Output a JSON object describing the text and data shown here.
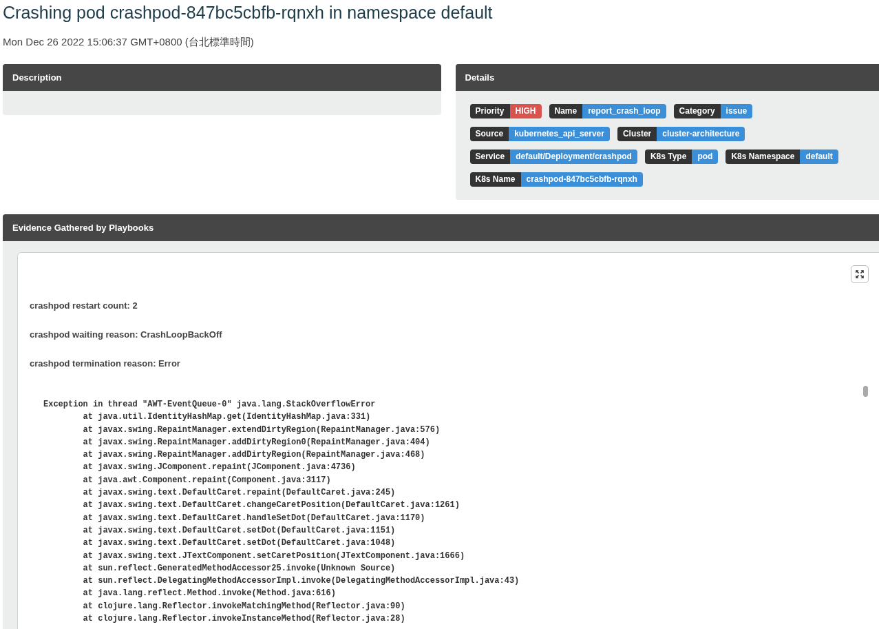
{
  "title": "Crashing pod crashpod-847bc5cbfb-rqnxh in namespace default",
  "timestamp": "Mon Dec 26 2022 15:06:37 GMT+0800 (台北標準時間)",
  "description": {
    "title": "Description"
  },
  "details": {
    "title": "Details",
    "rows": [
      [
        {
          "label": "Priority",
          "value": "HIGH",
          "color": "#d9534f"
        },
        {
          "label": "Name",
          "value": "report_crash_loop",
          "color": "#3a8fd8"
        },
        {
          "label": "Category",
          "value": "issue",
          "color": "#3a8fd8"
        }
      ],
      [
        {
          "label": "Source",
          "value": "kubernetes_api_server",
          "color": "#3a8fd8"
        },
        {
          "label": "Cluster",
          "value": "cluster-architecture",
          "color": "#3a8fd8"
        }
      ],
      [
        {
          "label": "Service",
          "value": "default/Deployment/crashpod",
          "color": "#3a8fd8"
        },
        {
          "label": "K8s Type",
          "value": "pod",
          "color": "#3a8fd8"
        },
        {
          "label": "K8s Namespace",
          "value": "default",
          "color": "#3a8fd8"
        }
      ],
      [
        {
          "label": "K8s Name",
          "value": "crashpod-847bc5cbfb-rqnxh",
          "color": "#3a8fd8"
        }
      ]
    ]
  },
  "evidence": {
    "title": "Evidence Gathered by Playbooks",
    "facts": [
      "crashpod restart count: 2",
      "crashpod waiting reason: CrashLoopBackOff",
      "crashpod termination reason: Error"
    ],
    "log": [
      "Exception in thread \"AWT-EventQueue-0\" java.lang.StackOverflowError",
      "\tat java.util.IdentityHashMap.get(IdentityHashMap.java:331)",
      "\tat javax.swing.RepaintManager.extendDirtyRegion(RepaintManager.java:576)",
      "\tat javax.swing.RepaintManager.addDirtyRegion0(RepaintManager.java:404)",
      "\tat javax.swing.RepaintManager.addDirtyRegion(RepaintManager.java:468)",
      "\tat javax.swing.JComponent.repaint(JComponent.java:4736)",
      "\tat java.awt.Component.repaint(Component.java:3117)",
      "\tat javax.swing.text.DefaultCaret.repaint(DefaultCaret.java:245)",
      "\tat javax.swing.text.DefaultCaret.changeCaretPosition(DefaultCaret.java:1261)",
      "\tat javax.swing.text.DefaultCaret.handleSetDot(DefaultCaret.java:1170)",
      "\tat javax.swing.text.DefaultCaret.setDot(DefaultCaret.java:1151)",
      "\tat javax.swing.text.DefaultCaret.setDot(DefaultCaret.java:1048)",
      "\tat javax.swing.text.JTextComponent.setCaretPosition(JTextComponent.java:1666)",
      "\tat sun.reflect.GeneratedMethodAccessor25.invoke(Unknown Source)",
      "\tat sun.reflect.DelegatingMethodAccessorImpl.invoke(DelegatingMethodAccessorImpl.java:43)",
      "\tat java.lang.reflect.Method.invoke(Method.java:616)",
      "\tat clojure.lang.Reflector.invokeMatchingMethod(Reflector.java:90)",
      "\tat clojure.lang.Reflector.invokeInstanceMethod(Reflector.java:28)"
    ]
  }
}
